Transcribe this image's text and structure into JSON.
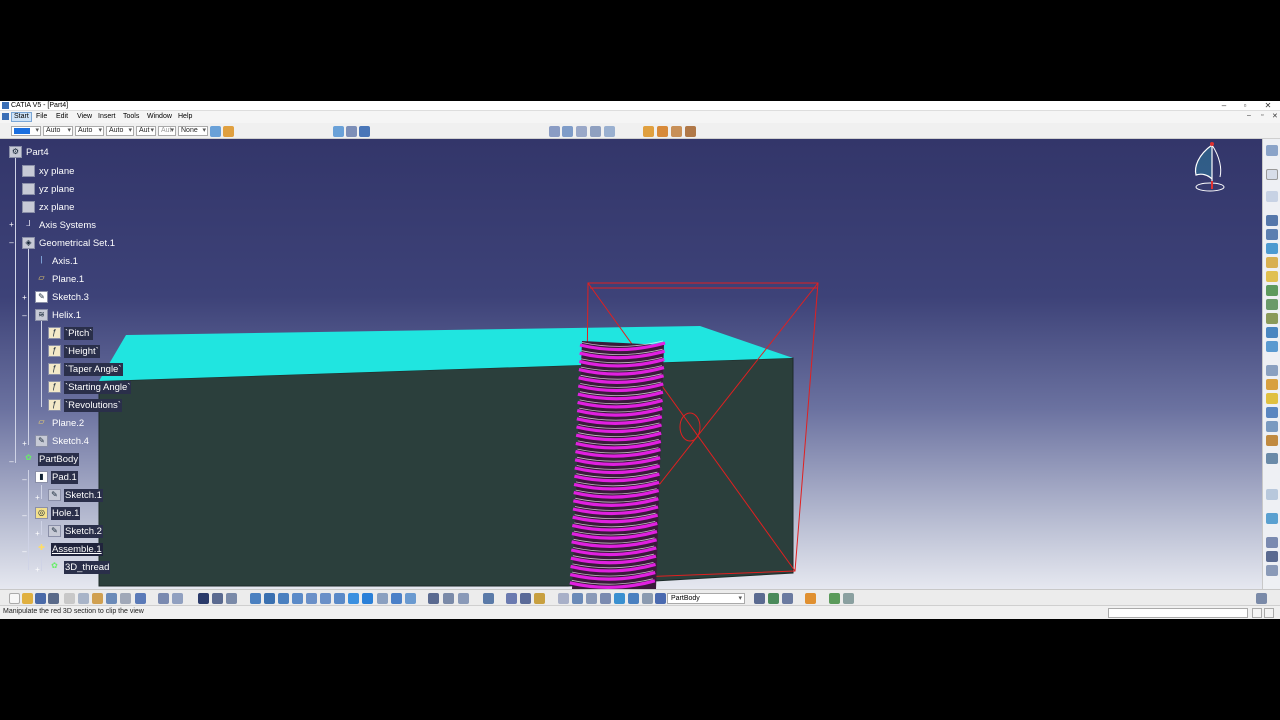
{
  "window": {
    "title": "CATIA V5 - [Part4]",
    "controls": {
      "minimize": "–",
      "maximize": "▫",
      "close": "✕"
    }
  },
  "menu": {
    "items": [
      "Start",
      "File",
      "Edit",
      "View",
      "Insert",
      "Tools",
      "Window",
      "Help"
    ],
    "active": "Start",
    "doc_controls": {
      "minimize": "–",
      "restore": "▫",
      "close": "✕"
    }
  },
  "properties_toolbar": {
    "color": "#1a6fe0",
    "combo_values": [
      "Auto",
      "Auto",
      "Auto",
      "Aut",
      "Aut",
      "None"
    ]
  },
  "tree": {
    "nodes": [
      {
        "label": "Part4",
        "icon": "part-icon"
      },
      {
        "label": "xy plane",
        "icon": "plane-icon"
      },
      {
        "label": "yz plane",
        "icon": "plane-icon"
      },
      {
        "label": "zx plane",
        "icon": "plane-icon"
      },
      {
        "label": "Axis Systems",
        "icon": "axis-system-icon"
      },
      {
        "label": "Geometrical Set.1",
        "icon": "geometrical-set-icon"
      },
      {
        "label": "Axis.1",
        "icon": "axis-icon"
      },
      {
        "label": "Plane.1",
        "icon": "plane-feature-icon"
      },
      {
        "label": "Sketch.3",
        "icon": "sketch-icon"
      },
      {
        "label": "Helix.1",
        "icon": "helix-icon"
      },
      {
        "label": "`Pitch`",
        "icon": "parameter-icon"
      },
      {
        "label": "`Height`",
        "icon": "parameter-icon"
      },
      {
        "label": "`Taper Angle`",
        "icon": "parameter-icon"
      },
      {
        "label": "`Starting Angle`",
        "icon": "parameter-icon"
      },
      {
        "label": "`Revolutions`",
        "icon": "parameter-icon"
      },
      {
        "label": "Plane.2",
        "icon": "plane-feature-icon"
      },
      {
        "label": "Sketch.4",
        "icon": "sketch-icon"
      },
      {
        "label": "PartBody",
        "icon": "partbody-icon"
      },
      {
        "label": "Pad.1",
        "icon": "pad-icon"
      },
      {
        "label": "Sketch.1",
        "icon": "sketch-icon"
      },
      {
        "label": "Hole.1",
        "icon": "hole-icon"
      },
      {
        "label": "Sketch.2",
        "icon": "sketch-icon"
      },
      {
        "label": "Assemble.1",
        "icon": "assemble-icon"
      },
      {
        "label": "3D_thread",
        "icon": "body-icon"
      }
    ]
  },
  "scene": {
    "block_top_color": "#20e5e0",
    "block_side_color": "#2b3f3c",
    "thread_color": "#e020e0",
    "section_box_color": "#e02020"
  },
  "bottom_toolbar": {
    "current_body": "PartBody"
  },
  "status": {
    "message": "Manipulate the red 3D section to clip the view"
  }
}
